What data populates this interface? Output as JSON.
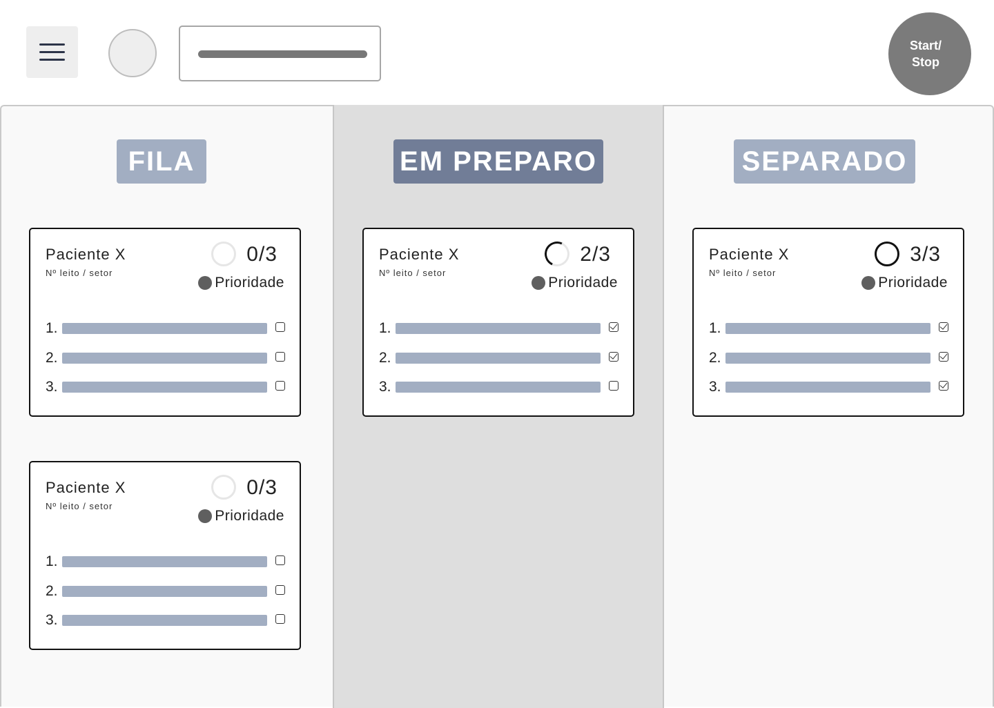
{
  "header": {
    "start_stop_label": "Start/\nStop"
  },
  "columns": [
    {
      "title": "FILA",
      "cards": [
        {
          "patient": "Paciente X",
          "bed": "Nº leito / setor",
          "progress": "0/3",
          "priority": "Prioridade",
          "items": [
            {
              "num": "1.",
              "checked": false
            },
            {
              "num": "2.",
              "checked": false
            },
            {
              "num": "3.",
              "checked": false
            }
          ]
        },
        {
          "patient": "Paciente X",
          "bed": "Nº leito / setor",
          "progress": "0/3",
          "priority": "Prioridade",
          "items": [
            {
              "num": "1.",
              "checked": false
            },
            {
              "num": "2.",
              "checked": false
            },
            {
              "num": "3.",
              "checked": false
            }
          ]
        }
      ]
    },
    {
      "title": "EM PREPARO",
      "cards": [
        {
          "patient": "Paciente X",
          "bed": "Nº leito / setor",
          "progress": "2/3",
          "priority": "Prioridade",
          "items": [
            {
              "num": "1.",
              "checked": true
            },
            {
              "num": "2.",
              "checked": true
            },
            {
              "num": "3.",
              "checked": false
            }
          ]
        }
      ]
    },
    {
      "title": "SEPARADO",
      "cards": [
        {
          "patient": "Paciente X",
          "bed": "Nº leito / setor",
          "progress": "3/3",
          "priority": "Prioridade",
          "items": [
            {
              "num": "1.",
              "checked": true
            },
            {
              "num": "2.",
              "checked": true
            },
            {
              "num": "3.",
              "checked": true
            }
          ]
        }
      ]
    }
  ]
}
